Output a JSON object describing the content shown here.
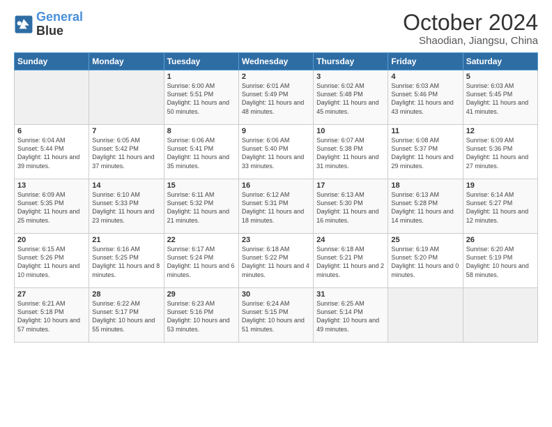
{
  "logo": {
    "line1": "General",
    "line2": "Blue"
  },
  "title": "October 2024",
  "subtitle": "Shaodian, Jiangsu, China",
  "weekdays": [
    "Sunday",
    "Monday",
    "Tuesday",
    "Wednesday",
    "Thursday",
    "Friday",
    "Saturday"
  ],
  "weeks": [
    [
      {
        "day": "",
        "info": ""
      },
      {
        "day": "",
        "info": ""
      },
      {
        "day": "1",
        "info": "Sunrise: 6:00 AM\nSunset: 5:51 PM\nDaylight: 11 hours and 50 minutes."
      },
      {
        "day": "2",
        "info": "Sunrise: 6:01 AM\nSunset: 5:49 PM\nDaylight: 11 hours and 48 minutes."
      },
      {
        "day": "3",
        "info": "Sunrise: 6:02 AM\nSunset: 5:48 PM\nDaylight: 11 hours and 45 minutes."
      },
      {
        "day": "4",
        "info": "Sunrise: 6:03 AM\nSunset: 5:46 PM\nDaylight: 11 hours and 43 minutes."
      },
      {
        "day": "5",
        "info": "Sunrise: 6:03 AM\nSunset: 5:45 PM\nDaylight: 11 hours and 41 minutes."
      }
    ],
    [
      {
        "day": "6",
        "info": "Sunrise: 6:04 AM\nSunset: 5:44 PM\nDaylight: 11 hours and 39 minutes."
      },
      {
        "day": "7",
        "info": "Sunrise: 6:05 AM\nSunset: 5:42 PM\nDaylight: 11 hours and 37 minutes."
      },
      {
        "day": "8",
        "info": "Sunrise: 6:06 AM\nSunset: 5:41 PM\nDaylight: 11 hours and 35 minutes."
      },
      {
        "day": "9",
        "info": "Sunrise: 6:06 AM\nSunset: 5:40 PM\nDaylight: 11 hours and 33 minutes."
      },
      {
        "day": "10",
        "info": "Sunrise: 6:07 AM\nSunset: 5:38 PM\nDaylight: 11 hours and 31 minutes."
      },
      {
        "day": "11",
        "info": "Sunrise: 6:08 AM\nSunset: 5:37 PM\nDaylight: 11 hours and 29 minutes."
      },
      {
        "day": "12",
        "info": "Sunrise: 6:09 AM\nSunset: 5:36 PM\nDaylight: 11 hours and 27 minutes."
      }
    ],
    [
      {
        "day": "13",
        "info": "Sunrise: 6:09 AM\nSunset: 5:35 PM\nDaylight: 11 hours and 25 minutes."
      },
      {
        "day": "14",
        "info": "Sunrise: 6:10 AM\nSunset: 5:33 PM\nDaylight: 11 hours and 23 minutes."
      },
      {
        "day": "15",
        "info": "Sunrise: 6:11 AM\nSunset: 5:32 PM\nDaylight: 11 hours and 21 minutes."
      },
      {
        "day": "16",
        "info": "Sunrise: 6:12 AM\nSunset: 5:31 PM\nDaylight: 11 hours and 18 minutes."
      },
      {
        "day": "17",
        "info": "Sunrise: 6:13 AM\nSunset: 5:30 PM\nDaylight: 11 hours and 16 minutes."
      },
      {
        "day": "18",
        "info": "Sunrise: 6:13 AM\nSunset: 5:28 PM\nDaylight: 11 hours and 14 minutes."
      },
      {
        "day": "19",
        "info": "Sunrise: 6:14 AM\nSunset: 5:27 PM\nDaylight: 11 hours and 12 minutes."
      }
    ],
    [
      {
        "day": "20",
        "info": "Sunrise: 6:15 AM\nSunset: 5:26 PM\nDaylight: 11 hours and 10 minutes."
      },
      {
        "day": "21",
        "info": "Sunrise: 6:16 AM\nSunset: 5:25 PM\nDaylight: 11 hours and 8 minutes."
      },
      {
        "day": "22",
        "info": "Sunrise: 6:17 AM\nSunset: 5:24 PM\nDaylight: 11 hours and 6 minutes."
      },
      {
        "day": "23",
        "info": "Sunrise: 6:18 AM\nSunset: 5:22 PM\nDaylight: 11 hours and 4 minutes."
      },
      {
        "day": "24",
        "info": "Sunrise: 6:18 AM\nSunset: 5:21 PM\nDaylight: 11 hours and 2 minutes."
      },
      {
        "day": "25",
        "info": "Sunrise: 6:19 AM\nSunset: 5:20 PM\nDaylight: 11 hours and 0 minutes."
      },
      {
        "day": "26",
        "info": "Sunrise: 6:20 AM\nSunset: 5:19 PM\nDaylight: 10 hours and 58 minutes."
      }
    ],
    [
      {
        "day": "27",
        "info": "Sunrise: 6:21 AM\nSunset: 5:18 PM\nDaylight: 10 hours and 57 minutes."
      },
      {
        "day": "28",
        "info": "Sunrise: 6:22 AM\nSunset: 5:17 PM\nDaylight: 10 hours and 55 minutes."
      },
      {
        "day": "29",
        "info": "Sunrise: 6:23 AM\nSunset: 5:16 PM\nDaylight: 10 hours and 53 minutes."
      },
      {
        "day": "30",
        "info": "Sunrise: 6:24 AM\nSunset: 5:15 PM\nDaylight: 10 hours and 51 minutes."
      },
      {
        "day": "31",
        "info": "Sunrise: 6:25 AM\nSunset: 5:14 PM\nDaylight: 10 hours and 49 minutes."
      },
      {
        "day": "",
        "info": ""
      },
      {
        "day": "",
        "info": ""
      }
    ]
  ]
}
